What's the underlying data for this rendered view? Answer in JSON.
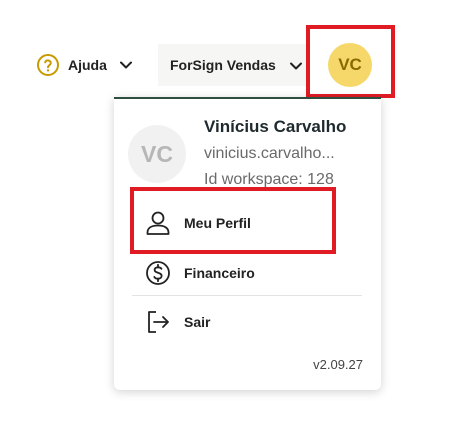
{
  "header": {
    "help_label": "Ajuda",
    "workspace_label": "ForSign Vendas",
    "avatar_initials": "VC"
  },
  "user_menu": {
    "avatar_initials": "VC",
    "name": "Vinícius Carvalho",
    "email": "vinicius.carvalho...",
    "workspace_id": "Id workspace: 128",
    "items": [
      {
        "label": "Meu Perfil",
        "icon": "user-icon"
      },
      {
        "label": "Financeiro",
        "icon": "dollar-circle-icon"
      },
      {
        "label": "Sair",
        "icon": "logout-icon"
      }
    ],
    "version": "v2.09.27"
  },
  "colors": {
    "accent": "#2e4f3e",
    "avatar_bg": "#f6d86a",
    "help_icon": "#c99a00",
    "highlight": "#e01b24"
  }
}
